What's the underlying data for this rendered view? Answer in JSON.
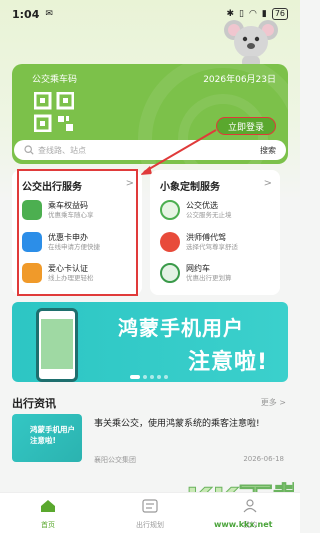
{
  "status_bar": {
    "time": "1:04",
    "battery": "76"
  },
  "card": {
    "title": "公交乘车码",
    "date": "2026年06月23日",
    "login_button": "立即登录"
  },
  "search": {
    "placeholder": "查线路、站点",
    "button": "搜索"
  },
  "left_panel": {
    "title": "公交出行服务",
    "more": ">",
    "items": [
      {
        "title": "乘车权益码",
        "subtitle": "优惠乘车随心享",
        "color": "#4caf50"
      },
      {
        "title": "优惠卡申办",
        "subtitle": "在线申请方便快捷",
        "color": "#2c8ee8"
      },
      {
        "title": "爱心卡认证",
        "subtitle": "线上办理更轻松",
        "color": "#f09a2a"
      }
    ]
  },
  "right_panel": {
    "title": "小象定制服务",
    "more": ">",
    "items": [
      {
        "title": "公交优选",
        "subtitle": "公交服务无止境",
        "color": "#4caf50"
      },
      {
        "title": "洪师傅代驾",
        "subtitle": "选择代驾尊享舒适",
        "color": "#e84b3a"
      },
      {
        "title": "网约车",
        "subtitle": "优惠出行更划算",
        "color": "#3a9a4a"
      }
    ]
  },
  "banner": {
    "line1": "鸿蒙手机用户",
    "line2": "注意啦!"
  },
  "news": {
    "header": "出行资讯",
    "more": "更多 >",
    "item": {
      "thumb_text": "鸿蒙手机用户 注意啦!",
      "title": "事关乘公交，使用鸿蒙系统的乘客注意啦!",
      "source": "襄阳公交集团",
      "date": "2026-06-18"
    }
  },
  "tabs": [
    {
      "label": "首页",
      "active": true
    },
    {
      "label": "出行规划",
      "active": false
    },
    {
      "label": "我的",
      "active": false
    }
  ],
  "watermark": {
    "text": "KK下载",
    "url": "www.kkx.net"
  },
  "colors": {
    "brand_green": "#7cc14a",
    "accent_green": "#5aa82e",
    "annotation_red": "#e03a3a",
    "banner_teal": "#2dc6c4"
  }
}
